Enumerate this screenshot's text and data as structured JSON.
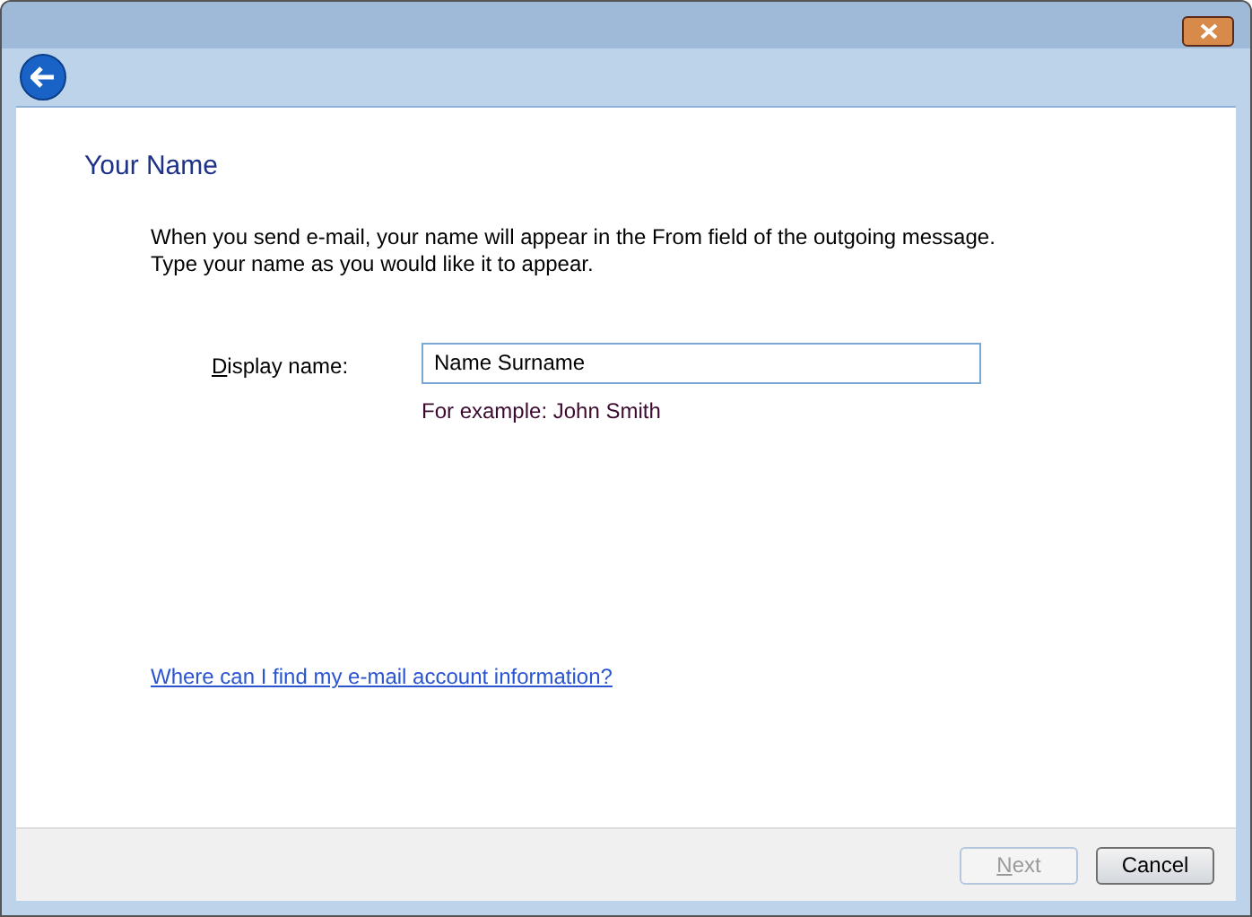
{
  "heading": "Your Name",
  "intro": [
    "When you send e-mail, your name will appear in the From field of the outgoing message.",
    "Type your name as you would like it to appear."
  ],
  "display_name": {
    "mnemonic": "D",
    "label_rest": "isplay name:",
    "value": "Name Surname",
    "hint": "For example: John Smith"
  },
  "help_link": "Where can I find my e-mail account information?",
  "buttons": [
    {
      "mnemonic": "N",
      "label_rest": "ext",
      "disabled": true
    },
    {
      "label_rest": "Cancel",
      "disabled": false
    }
  ]
}
